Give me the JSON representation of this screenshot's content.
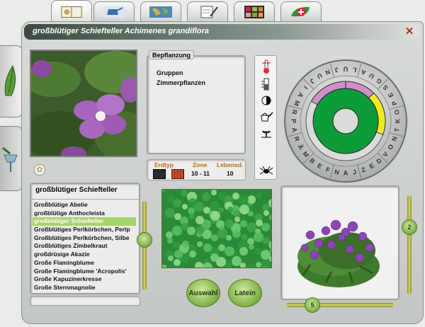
{
  "window": {
    "title": "großblütiger Schiefteller Achimenes grandiflora",
    "close_glyph": "✕"
  },
  "top_tabs": [
    {
      "icon": "book-icon",
      "color": "#c9a24a"
    },
    {
      "icon": "watering-can-icon",
      "color": "#3a6fb0"
    },
    {
      "icon": "world-map-icon",
      "color": "#4d86b8"
    },
    {
      "icon": "notepad-pen-icon",
      "color": "#d0d4d0"
    },
    {
      "icon": "photo-grid-icon",
      "color": "#7a4a2a"
    },
    {
      "icon": "leaf-plus-icon",
      "color": "#2f8f3a"
    }
  ],
  "side_tabs": [
    {
      "icon": "plant-leaf-icon"
    },
    {
      "icon": "watering-tools-icon"
    }
  ],
  "groups": {
    "title": "Bepflanzung",
    "items": [
      "Gruppen",
      "Zimmerpflanzen"
    ]
  },
  "soil": {
    "headers": {
      "soil": "Erdtyp",
      "zone": "Zone",
      "life": "Lebensd."
    },
    "zone": "10 - 11",
    "life": "10"
  },
  "plant_list": {
    "header": "großblütiger Schiefteller",
    "items": [
      "Großblütige Abelie",
      "großblütige Anthocleista",
      "großblütiger Schiefteller",
      "Großblütiges Perlkörbchen, Perlp",
      "Großblütiges Perlkörbchen, Silbe",
      "Großblütiges Zimbelkraut",
      "großdrüsige Akazie",
      "Große Flamingblume",
      "Große Flamingblume 'Acropolis'",
      "Große Kapuzinerkresse",
      "Große Sternmagnolie"
    ],
    "selected_index": 2
  },
  "buttons": {
    "select": "Auswahl",
    "latin": "Latein"
  },
  "sliders": {
    "vertical_right_label": "2",
    "horizontal_label": "5"
  },
  "calendar": {
    "months": [
      "JAN",
      "FEB",
      "MÄR",
      "APR",
      "MAI",
      "JUN",
      "JUL",
      "AUG",
      "SEP",
      "OKT",
      "NOV",
      "DEZ"
    ],
    "colors": {
      "bloom": "#ce90c8",
      "yellow": "#f0ea20",
      "green": "#0e9c3a",
      "dark": "#2f3a2f"
    }
  },
  "properties_icons": [
    "thermometer-icon",
    "water-level-icon",
    "half-sun-icon",
    "watering-can-icon",
    "seedling-icon",
    "spider-pest-icon"
  ]
}
